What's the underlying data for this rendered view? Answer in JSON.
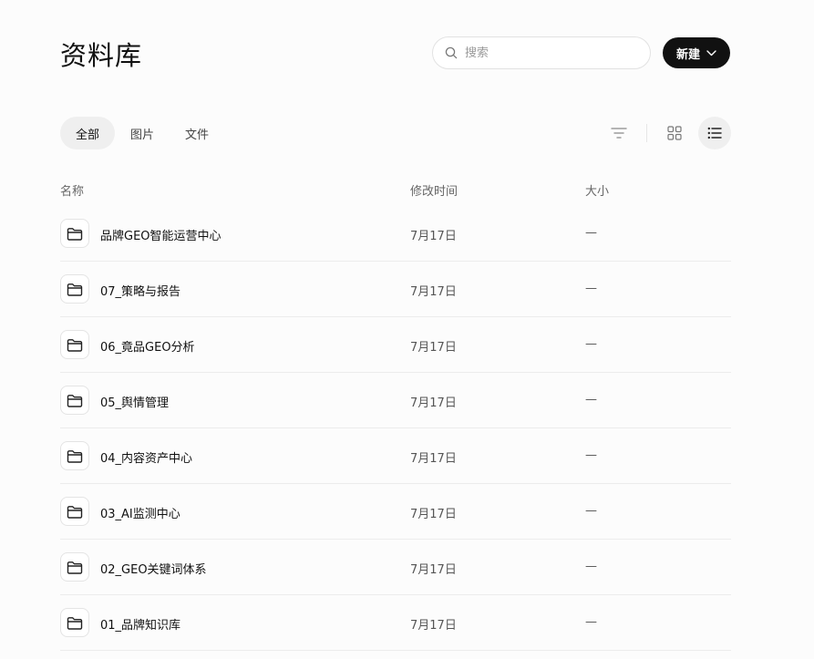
{
  "header": {
    "title": "资料库",
    "search_placeholder": "搜索",
    "new_label": "新建"
  },
  "tabs": [
    {
      "label": "全部",
      "active": true
    },
    {
      "label": "图片",
      "active": false
    },
    {
      "label": "文件",
      "active": false
    }
  ],
  "toolbar": {
    "filter_icon": "filter-icon",
    "grid_icon": "grid-view-icon",
    "list_icon": "list-view-icon",
    "active_view": "list"
  },
  "columns": {
    "name": "名称",
    "modified": "修改时间",
    "size": "大小"
  },
  "files": [
    {
      "name": "品牌GEO智能运营中心",
      "modified": "7月17日",
      "size": "—",
      "icon": "folder-icon"
    },
    {
      "name": "07_策略与报告",
      "modified": "7月17日",
      "size": "—",
      "icon": "folder-icon"
    },
    {
      "name": "06_竟品GEO分析",
      "modified": "7月17日",
      "size": "—",
      "icon": "folder-icon"
    },
    {
      "name": "05_舆情管理",
      "modified": "7月17日",
      "size": "—",
      "icon": "folder-icon"
    },
    {
      "name": "04_内容资产中心",
      "modified": "7月17日",
      "size": "—",
      "icon": "folder-icon"
    },
    {
      "name": "03_AI监测中心",
      "modified": "7月17日",
      "size": "—",
      "icon": "folder-icon"
    },
    {
      "name": "02_GEO关键词体系",
      "modified": "7月17日",
      "size": "—",
      "icon": "folder-icon"
    },
    {
      "name": "01_品牌知识库",
      "modified": "7月17日",
      "size": "—",
      "icon": "folder-icon"
    }
  ]
}
